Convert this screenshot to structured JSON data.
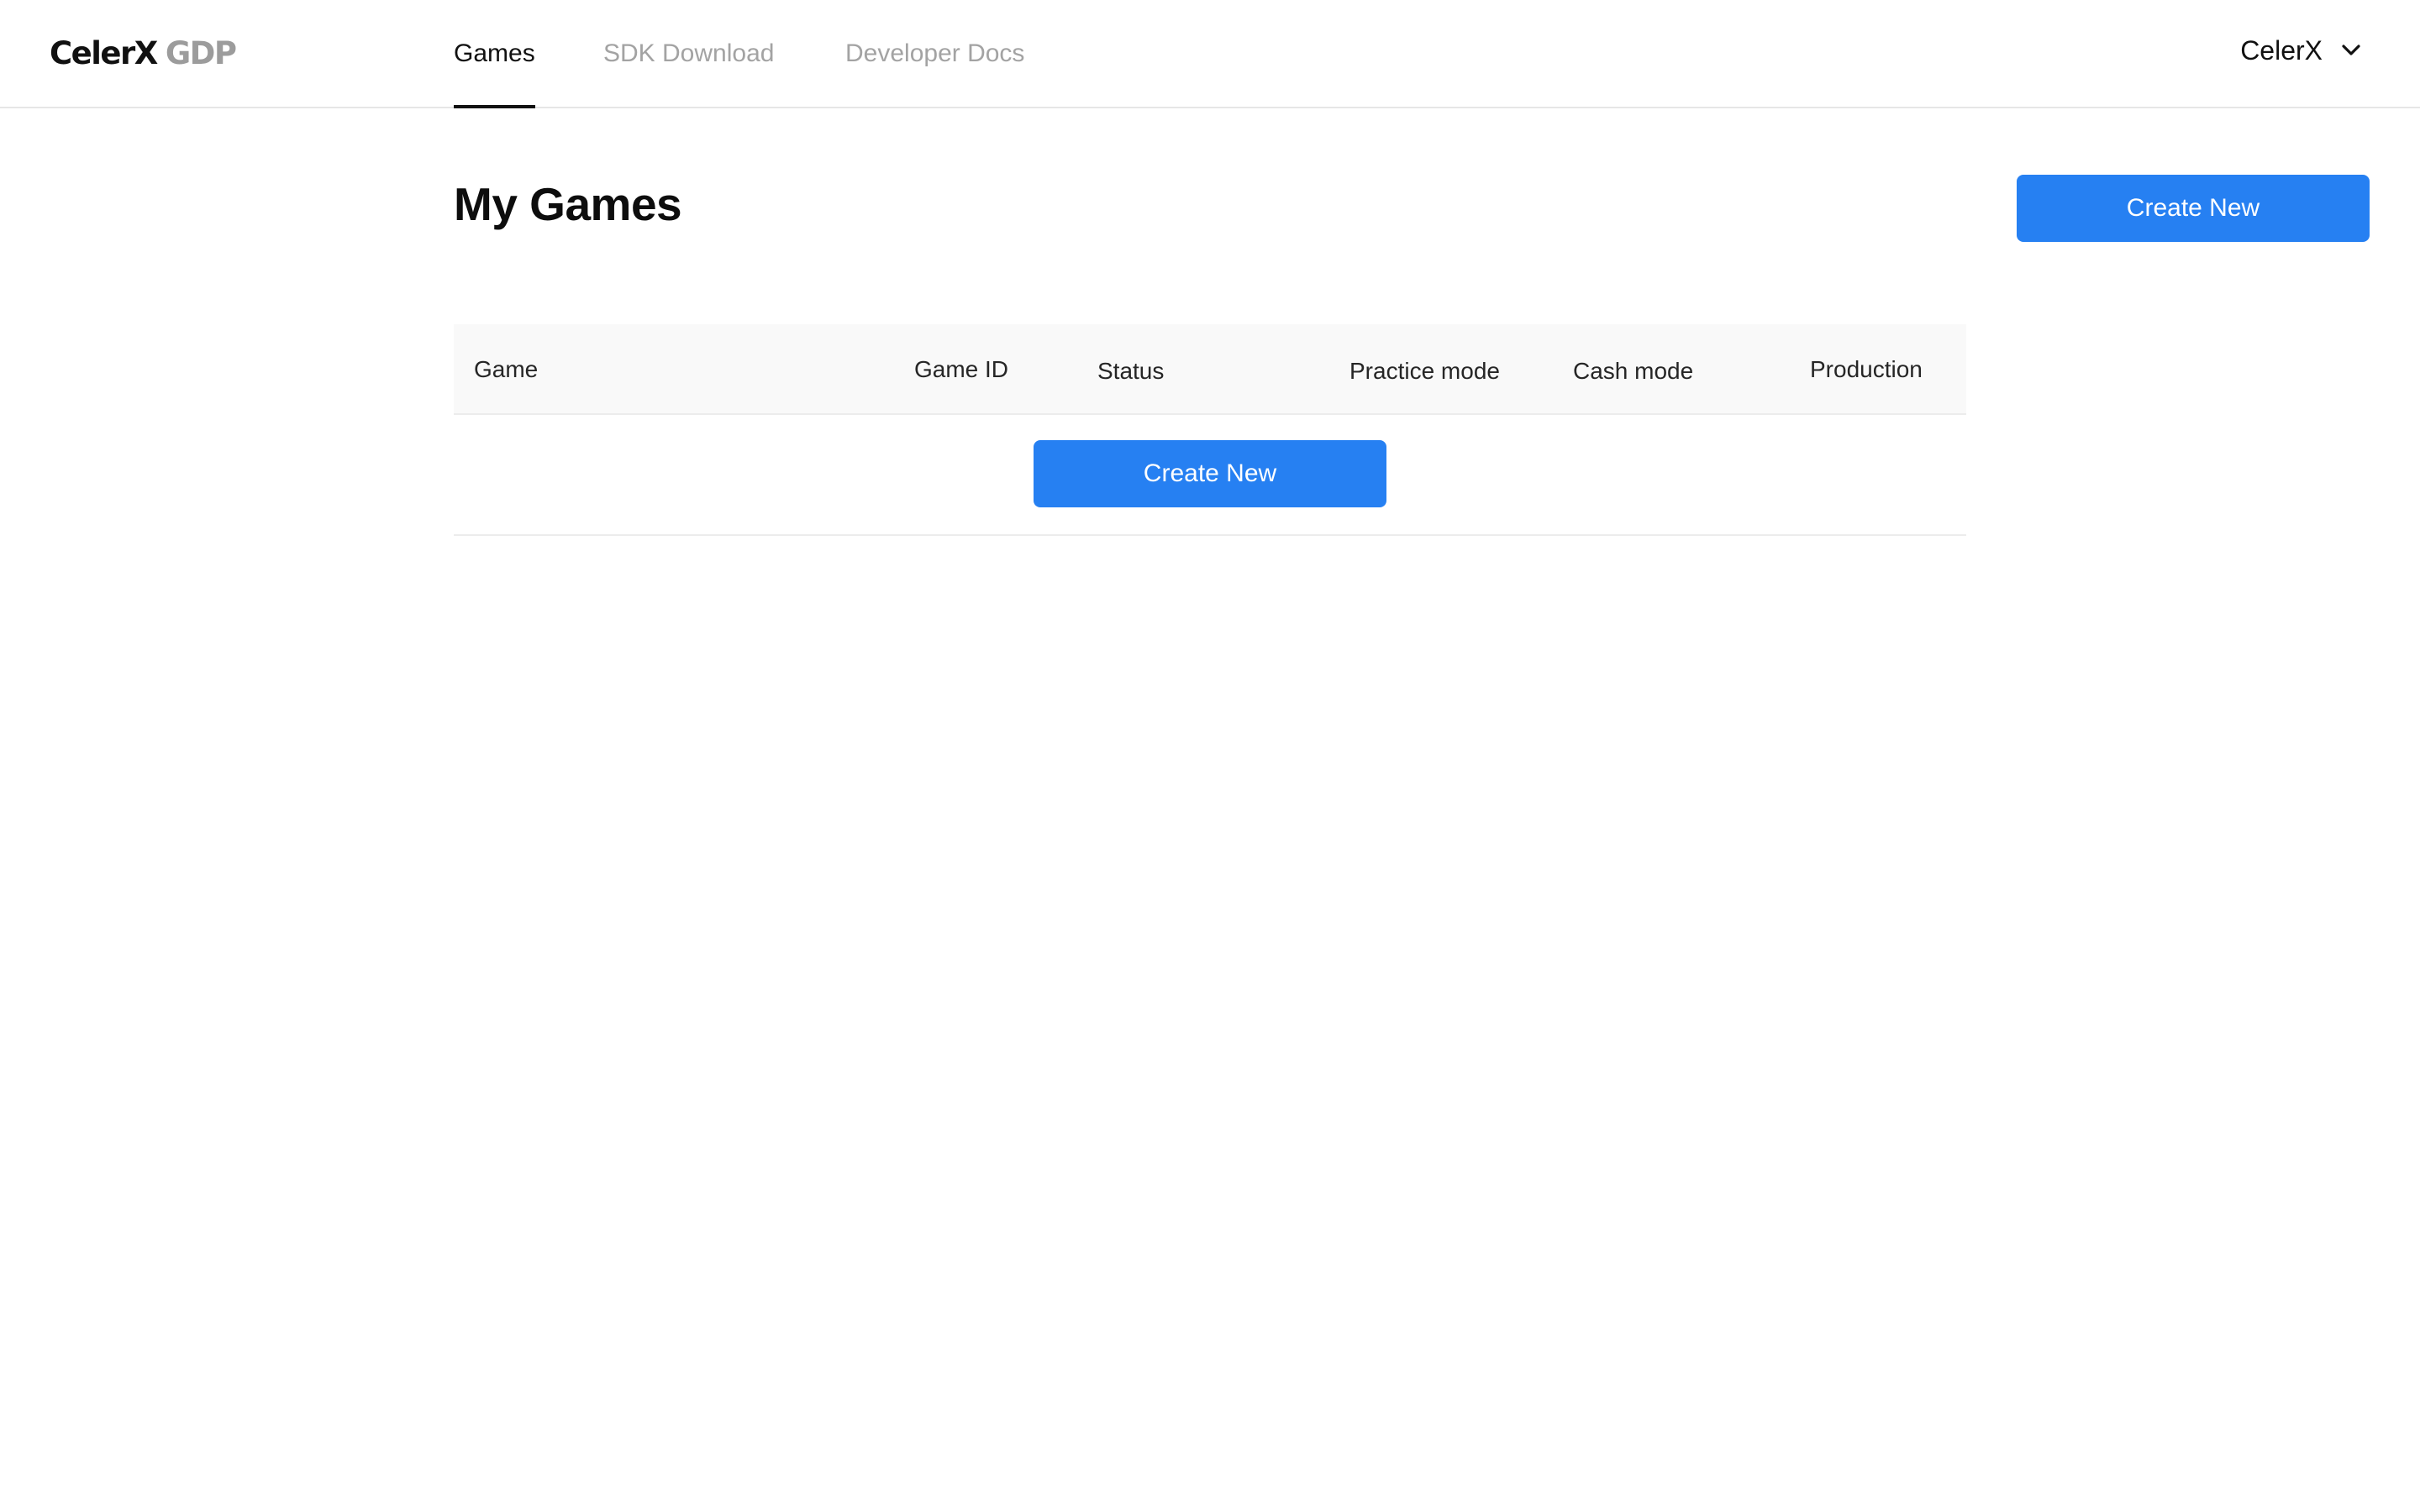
{
  "header": {
    "logo": {
      "brand": "CelerX",
      "product": "GDP"
    },
    "nav": [
      {
        "label": "Games",
        "active": true
      },
      {
        "label": "SDK Download",
        "active": false
      },
      {
        "label": "Developer Docs",
        "active": false
      }
    ],
    "account": {
      "name": "CelerX",
      "icon": "chevron-down-icon"
    }
  },
  "main": {
    "title": "My Games",
    "create_button": "Create New",
    "table": {
      "columns": [
        "Game",
        "Game ID",
        "Status",
        "Practice mode",
        "Cash mode",
        "Production"
      ],
      "rows": [],
      "empty_create_button": "Create New"
    }
  },
  "colors": {
    "primary": "#2680f2",
    "text": "#111111",
    "muted": "#a3a3a3",
    "table_header_bg": "#f9f9f9",
    "divider": "#e6e6e6"
  }
}
